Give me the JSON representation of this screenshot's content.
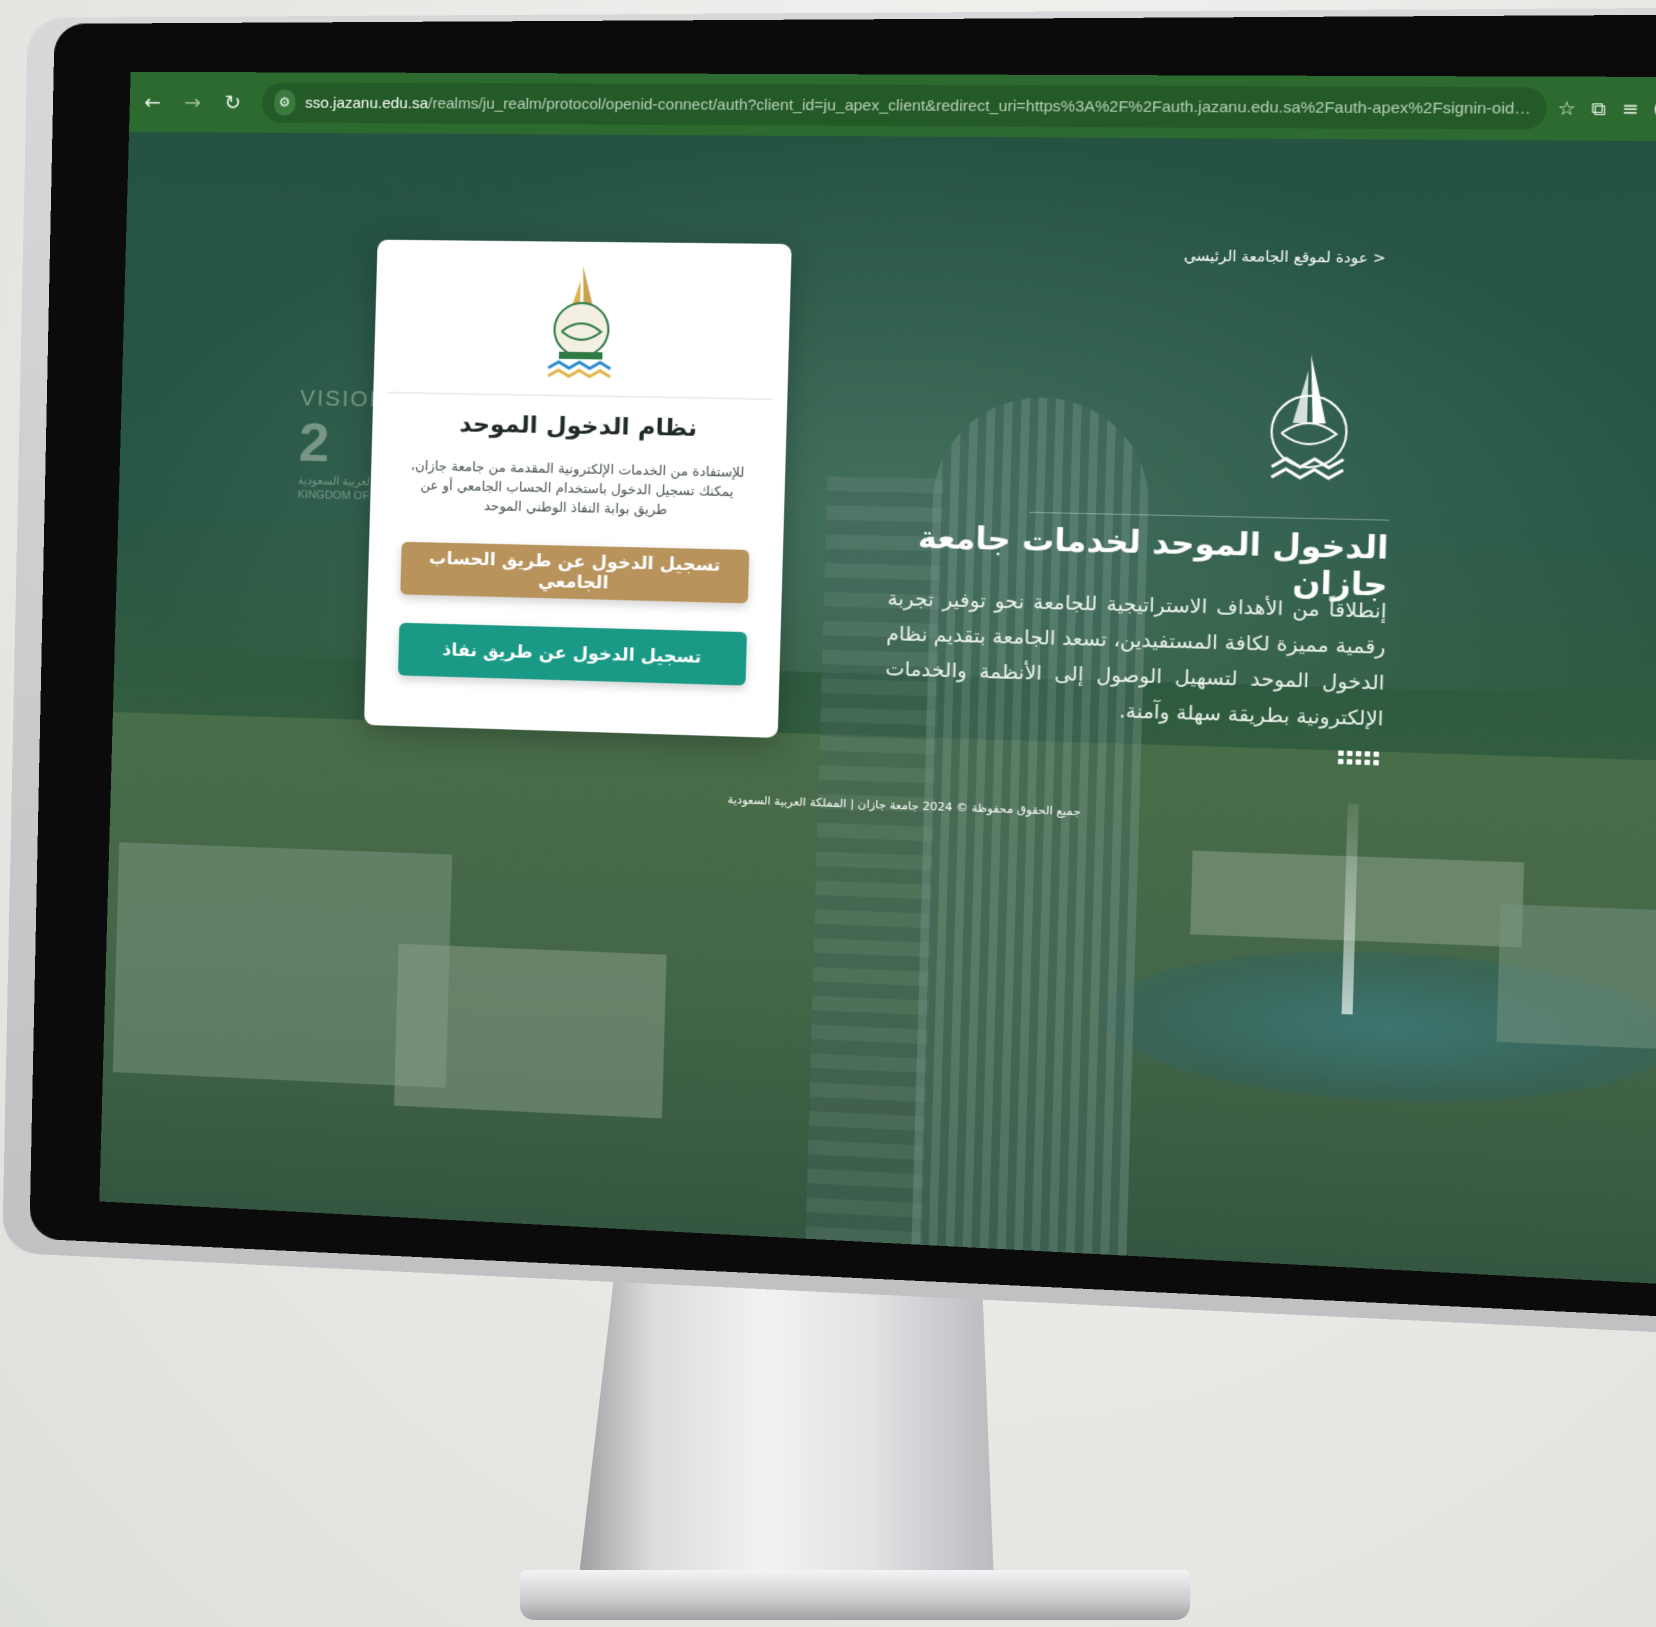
{
  "browser": {
    "url_domain": "sso.jazanu.edu.sa",
    "url_path": "/realms/ju_realm/protocol/openid-connect/auth?client_id=ju_apex_client&redirect_uri=https%3A%2F%2Fauth.jazanu.edu.sa%2Fauth-apex%2Fsignin-oidc&response_type=code&scope=openid...",
    "nav_back_icon": "←",
    "nav_forward_icon": "→",
    "reload_icon": "↻",
    "site_settings_icon": "⚙",
    "bookmark_icon": "☆",
    "extensions_icon": "⧉",
    "reading_list_icon": "≡",
    "menu_icon": "⋮"
  },
  "page": {
    "back_link": "< عودة لموقع الجامعة الرئيسي",
    "vision": {
      "word": "VISION",
      "year": "2",
      "sub_arabic": "المملكة العربية السعودية",
      "sub_english": "KINGDOM OF"
    },
    "hero": {
      "title": "الدخول الموحد لخدمات جامعة جازان",
      "text": "إنطلاقاً من الأهداف الاستراتيجية للجامعة نحو توفير تجربة رقمية مميزة لكافة المستفيدين، تسعد الجامعة بتقديم نظام الدخول الموحد لتسهيل الوصول إلى الأنظمة والخدمات الإلكترونية بطريقة سهلة وآمنة."
    },
    "card": {
      "title": "نظام الدخول الموحد",
      "description": "للإستفادة من الخدمات الإلكترونية المقدمة من جامعة جازان، يمكنك تسجيل الدخول باستخدام الحساب الجامعي أو عن طريق بوابة النفاذ الوطني الموحد",
      "btn_university": "تسجيل الدخول عن طريق الحساب الجامعي",
      "btn_nafath": "تسجيل الدخول عن طريق نفاذ"
    },
    "footer": "جميع الحقوق محفوظة © 2024 جامعة جازان | المملكة العربية السعودية"
  },
  "colors": {
    "browser_bar": "#2d6a2f",
    "btn_university": "#b8935c",
    "btn_nafath": "#1a9a86",
    "page_overlay": "#254c3f"
  }
}
